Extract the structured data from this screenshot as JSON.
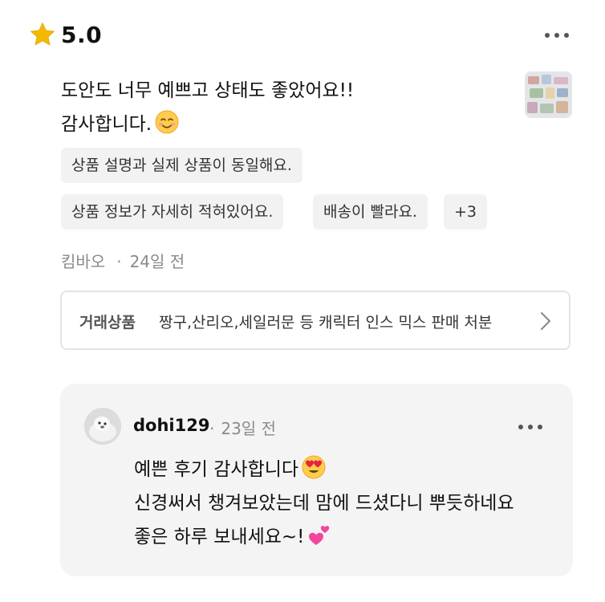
{
  "review": {
    "rating": "5.0",
    "text_lines": [
      "도안도 너무 예쁘고 상태도 좋았어요!!",
      "감사합니다."
    ],
    "emoji_after_text": "smiling-face-emoji",
    "tags": [
      "상품 설명과 실제 상품이 동일해요.",
      "상품 정보가 자세히 적혀있어요.",
      "배송이 빨라요.",
      "+3"
    ],
    "author": "킴바오",
    "time_separator": "·",
    "time_ago": "24일 전"
  },
  "deal": {
    "label": "거래상품",
    "title": "짱구,산리오,세일러문 등 캐릭터 인스 믹스 판매 처분"
  },
  "reply": {
    "user": "dohi129",
    "time_separator": "·",
    "time_ago": "23일 전",
    "lines": [
      "예쁜 후기 감사합니다",
      "신경써서 챙겨보았는데 맘에 드셨다니 뿌듯하네요",
      "좋은 하루 보내세요~!"
    ],
    "emojis": [
      "heart-eyes-emoji",
      "two-hearts-emoji"
    ]
  },
  "icons": [
    "star-icon",
    "more-options-icon",
    "chevron-right-icon",
    "avatar",
    "review-photo-thumbnail"
  ],
  "colors": {
    "star": "#F5B800",
    "tag_bg": "#F2F2F2",
    "reply_bg": "#F4F4F4",
    "muted_text": "#8A8A8A"
  }
}
